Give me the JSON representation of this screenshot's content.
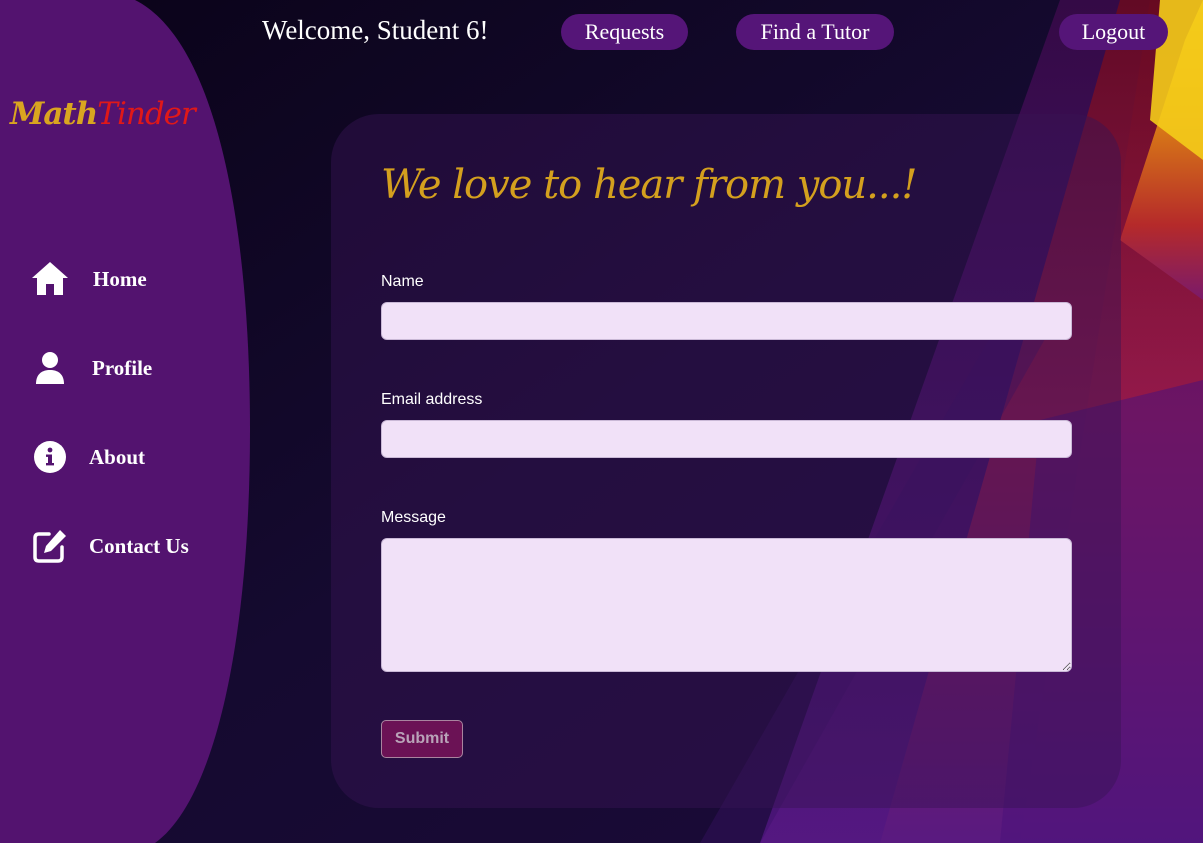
{
  "header": {
    "welcome": "Welcome, Student 6!",
    "nav": {
      "requests": "Requests",
      "find_tutor": "Find a Tutor",
      "logout": "Logout"
    }
  },
  "logo": {
    "part1": "Math",
    "part2": "Tinder"
  },
  "sidebar": {
    "items": [
      {
        "label": "Home",
        "icon": "home-icon"
      },
      {
        "label": "Profile",
        "icon": "user-icon"
      },
      {
        "label": "About",
        "icon": "info-icon"
      },
      {
        "label": "Contact Us",
        "icon": "edit-icon"
      }
    ]
  },
  "form": {
    "heading": "We love to hear from you...!",
    "name": {
      "label": "Name",
      "value": ""
    },
    "email": {
      "label": "Email address",
      "value": ""
    },
    "message": {
      "label": "Message",
      "value": ""
    },
    "submit": "Submit"
  },
  "colors": {
    "sidebar": "#53136f",
    "pill": "#551578",
    "heading": "#d4a01e",
    "logo_math": "#d9a520",
    "logo_tinder": "#e01818",
    "input_bg": "#f1e1f8",
    "submit_bg": "#6b1255"
  }
}
